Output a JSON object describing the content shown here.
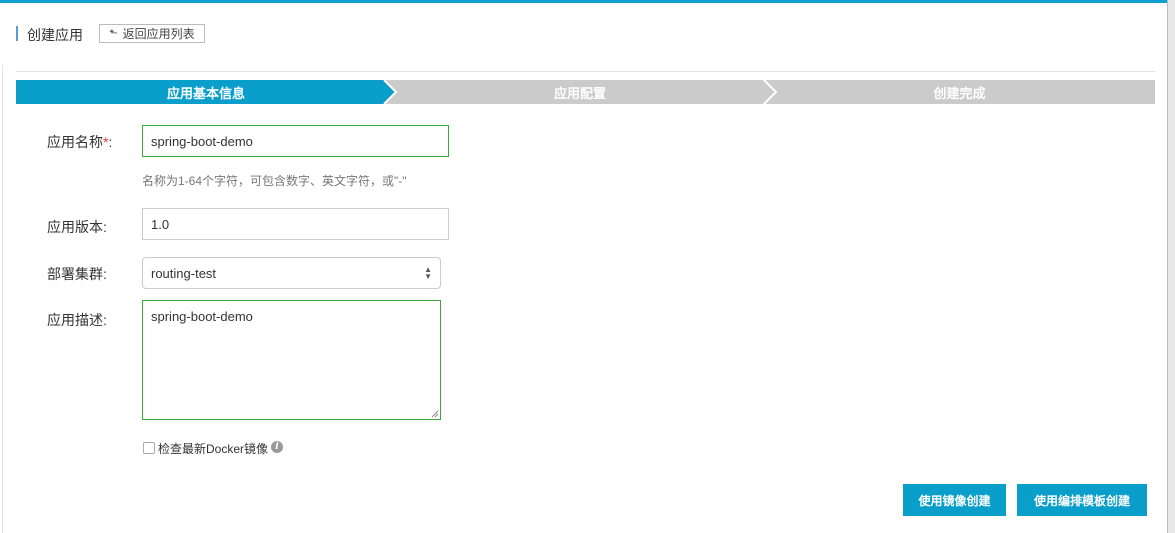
{
  "header": {
    "title": "创建应用",
    "back_button": "返回应用列表"
  },
  "steps": [
    {
      "label": "应用基本信息",
      "active": true
    },
    {
      "label": "应用配置",
      "active": false
    },
    {
      "label": "创建完成",
      "active": false
    }
  ],
  "form": {
    "name": {
      "label": "应用名称",
      "required_mark": "*",
      "colon": ":",
      "value": "spring-boot-demo",
      "hint": "名称为1-64个字符，可包含数字、英文字符，或\"-\""
    },
    "version": {
      "label": "应用版本:",
      "value": "1.0"
    },
    "cluster": {
      "label": "部署集群:",
      "value": "routing-test"
    },
    "description": {
      "label": "应用描述:",
      "value": "spring-boot-demo"
    },
    "check_docker": {
      "label": "检查最新Docker镜像",
      "checked": false
    }
  },
  "buttons": {
    "create_by_image": "使用镜像创建",
    "create_by_template": "使用编排模板创建"
  },
  "colors": {
    "accent": "#0a9fcb",
    "inactive_step": "#cbcbcb",
    "valid_border": "#3aab3a",
    "required": "#e33"
  }
}
